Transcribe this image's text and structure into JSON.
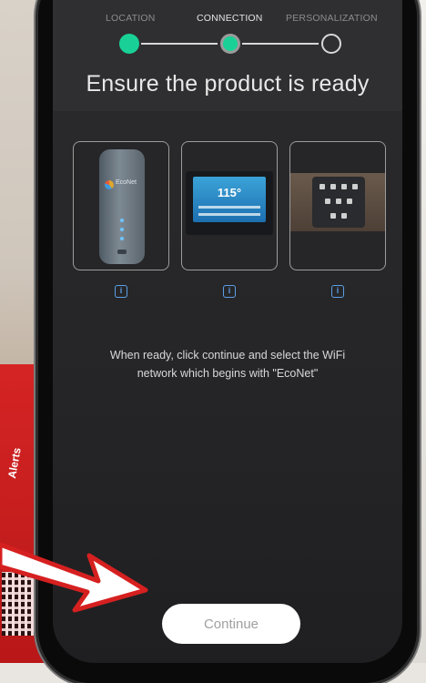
{
  "stepper": {
    "steps": [
      {
        "label": "LOCATION",
        "state": "complete"
      },
      {
        "label": "CONNECTION",
        "state": "current"
      },
      {
        "label": "PERSONALIZATION",
        "state": "pending"
      }
    ],
    "accent_color": "#19d196"
  },
  "main": {
    "title": "Ensure the product is ready",
    "products": [
      {
        "name": "wifi-module",
        "brand_text": "EcoNet"
      },
      {
        "name": "water-heater-display",
        "temp_text": "115°"
      },
      {
        "name": "control-panel"
      }
    ],
    "info_icon": "info-icon",
    "instructions_line1": "When ready, click continue and select the WiFi",
    "instructions_line2": "network which begins with \"EcoNet\""
  },
  "footer": {
    "continue_label": "Continue"
  },
  "background": {
    "card_text": "Alerts"
  }
}
